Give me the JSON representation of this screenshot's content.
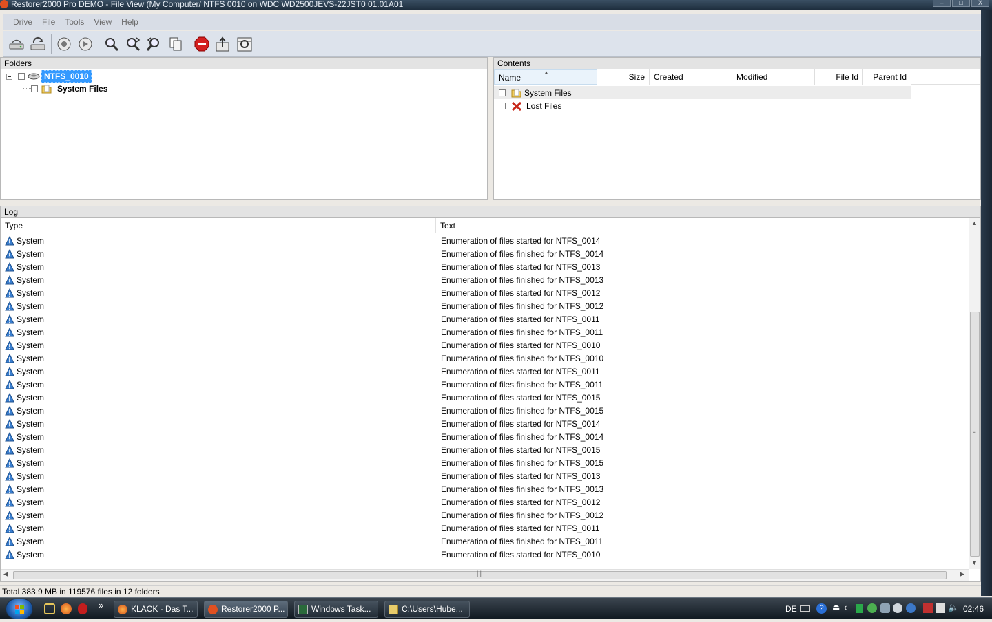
{
  "window": {
    "title": "Restorer2000 Pro DEMO - File View (My Computer/ NTFS 0010 on WDC WD2500JEVS-22JST0 01.01A01",
    "buttons": [
      "–",
      "□",
      "X"
    ]
  },
  "menubar": {
    "items": [
      "Drive",
      "File",
      "Tools",
      "View",
      "Help"
    ]
  },
  "toolbar": {
    "groups": [
      [
        "open-drive-icon",
        "refresh-icon"
      ],
      [
        "back-icon",
        "forward-icon"
      ],
      [
        "find-icon",
        "find-next-icon",
        "find-previous-icon",
        "copy-icon"
      ],
      [
        "stop-icon",
        "export-icon",
        "properties-icon"
      ]
    ]
  },
  "folders": {
    "header": "Folders",
    "root": "NTFS_0010",
    "child": "System Files"
  },
  "contents": {
    "header": "Contents",
    "columns": [
      "Name",
      "Size",
      "Created",
      "Modified",
      "File Id",
      "Parent Id"
    ],
    "rows": [
      {
        "name": "System Files",
        "icon": "folder-icon"
      },
      {
        "name": "Lost Files",
        "icon": "lost-files-icon"
      }
    ]
  },
  "log": {
    "header": "Log",
    "columns": [
      "Type",
      "Text"
    ],
    "rows": [
      {
        "type": "System",
        "text": "Enumeration of files started for NTFS_0014"
      },
      {
        "type": "System",
        "text": "Enumeration of files finished for NTFS_0014"
      },
      {
        "type": "System",
        "text": "Enumeration of files started for NTFS_0013"
      },
      {
        "type": "System",
        "text": "Enumeration of files finished for NTFS_0013"
      },
      {
        "type": "System",
        "text": "Enumeration of files started for NTFS_0012"
      },
      {
        "type": "System",
        "text": "Enumeration of files finished for NTFS_0012"
      },
      {
        "type": "System",
        "text": "Enumeration of files started for NTFS_0011"
      },
      {
        "type": "System",
        "text": "Enumeration of files finished for NTFS_0011"
      },
      {
        "type": "System",
        "text": "Enumeration of files started for NTFS_0010"
      },
      {
        "type": "System",
        "text": "Enumeration of files finished for NTFS_0010"
      },
      {
        "type": "System",
        "text": "Enumeration of files started for NTFS_0011"
      },
      {
        "type": "System",
        "text": "Enumeration of files finished for NTFS_0011"
      },
      {
        "type": "System",
        "text": "Enumeration of files started for NTFS_0015"
      },
      {
        "type": "System",
        "text": "Enumeration of files finished for NTFS_0015"
      },
      {
        "type": "System",
        "text": "Enumeration of files started for NTFS_0014"
      },
      {
        "type": "System",
        "text": "Enumeration of files finished for NTFS_0014"
      },
      {
        "type": "System",
        "text": "Enumeration of files started for NTFS_0015"
      },
      {
        "type": "System",
        "text": "Enumeration of files finished for NTFS_0015"
      },
      {
        "type": "System",
        "text": "Enumeration of files started for NTFS_0013"
      },
      {
        "type": "System",
        "text": "Enumeration of files finished for NTFS_0013"
      },
      {
        "type": "System",
        "text": "Enumeration of files started for NTFS_0012"
      },
      {
        "type": "System",
        "text": "Enumeration of files finished for NTFS_0012"
      },
      {
        "type": "System",
        "text": "Enumeration of files started for NTFS_0011"
      },
      {
        "type": "System",
        "text": "Enumeration of files finished for NTFS_0011"
      },
      {
        "type": "System",
        "text": "Enumeration of files started for NTFS_0010"
      }
    ]
  },
  "status": {
    "text": "Total 383.9 MB in 119576 files in 12 folders"
  },
  "taskbar": {
    "quick_launch_more": "»",
    "tasks": [
      "KLACK - Das T...",
      "Restorer2000 P...",
      "Windows Task...",
      "C:\\Users\\Hube..."
    ],
    "tray": {
      "language": "DE",
      "clock": "02:46"
    }
  },
  "colors": {
    "selection": "#3399ff",
    "toolbar_bg": "#dde3ec",
    "taskbar_bg": "#1a232d"
  }
}
